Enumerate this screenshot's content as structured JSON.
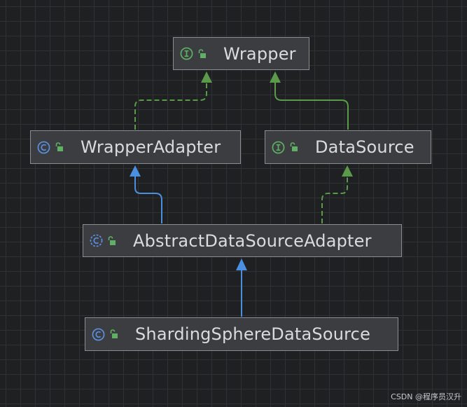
{
  "diagram": {
    "nodes": [
      {
        "id": "wrapper",
        "name": "Wrapper",
        "kind": "interface",
        "kind_icon": "interface-icon",
        "visibility_icon": "unlocked-icon"
      },
      {
        "id": "wrapper_adapter",
        "name": "WrapperAdapter",
        "kind": "class",
        "kind_icon": "class-icon",
        "visibility_icon": "unlocked-icon"
      },
      {
        "id": "data_source",
        "name": "DataSource",
        "kind": "interface",
        "kind_icon": "interface-icon",
        "visibility_icon": "unlocked-icon"
      },
      {
        "id": "abstract_adapter",
        "name": "AbstractDataSourceAdapter",
        "kind": "abstract-class",
        "kind_icon": "abstract-class-icon",
        "visibility_icon": "unlocked-icon"
      },
      {
        "id": "sharding",
        "name": "ShardingSphereDataSource",
        "kind": "class",
        "kind_icon": "class-icon",
        "visibility_icon": "unlocked-icon"
      }
    ],
    "edges": [
      {
        "from": "wrapper_adapter",
        "to": "wrapper",
        "relation": "implements",
        "style": "dashed"
      },
      {
        "from": "data_source",
        "to": "wrapper",
        "relation": "extends",
        "style": "solid"
      },
      {
        "from": "abstract_adapter",
        "to": "wrapper_adapter",
        "relation": "extends",
        "style": "solid"
      },
      {
        "from": "abstract_adapter",
        "to": "data_source",
        "relation": "implements",
        "style": "dashed"
      },
      {
        "from": "sharding",
        "to": "abstract_adapter",
        "relation": "extends",
        "style": "solid"
      }
    ]
  },
  "colors": {
    "background": "#1f2022",
    "node_fill": "#3b3d40",
    "node_border": "#8a8d91",
    "class_inheritance_edge": "#4a8fe0",
    "interface_edge": "#5a9a4a",
    "class_icon": "#5b8fe0",
    "interface_icon": "#5fb065",
    "lock_icon": "#5fb065"
  },
  "watermark": "CSDN @程序员汉升"
}
